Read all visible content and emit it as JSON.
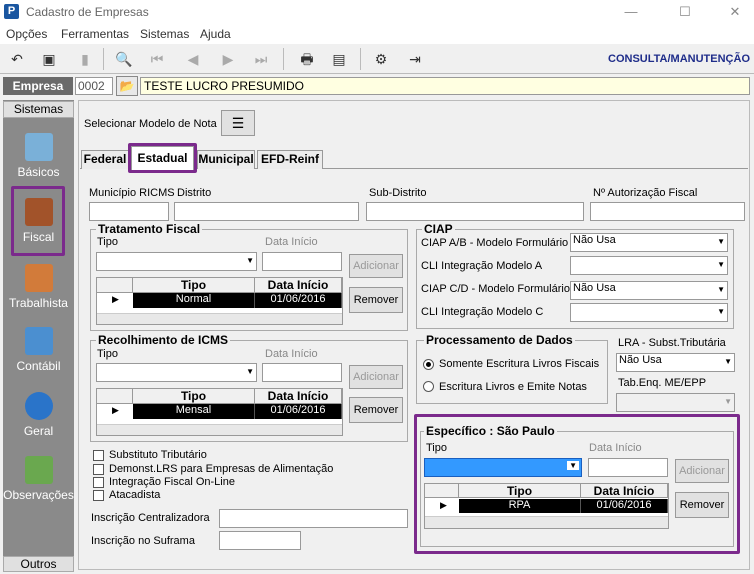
{
  "window": {
    "title": "Cadastro de Empresas",
    "app_letter": "P",
    "min": "—",
    "max": "☐",
    "close": "✕"
  },
  "menu": [
    "Opções",
    "Ferramentas",
    "Sistemas",
    "Ajuda"
  ],
  "toolbar": {
    "mode_label": "CONSULTA/MANUTENÇÃO"
  },
  "empresa": {
    "label": "Empresa",
    "code": "0002",
    "name": "TESTE LUCRO PRESUMIDO"
  },
  "sidebar": {
    "header": "Sistemas",
    "footer": "Outros",
    "items": [
      {
        "label": "Básicos",
        "icon": "document-icon"
      },
      {
        "label": "Fiscal",
        "icon": "book-icon"
      },
      {
        "label": "Trabalhista",
        "icon": "worker-icon"
      },
      {
        "label": "Contábil",
        "icon": "calculator-icon"
      },
      {
        "label": "Geral",
        "icon": "info-icon"
      },
      {
        "label": "Observações",
        "icon": "pen-icon"
      }
    ]
  },
  "modelo_nota": {
    "label": "Selecionar Modelo de Nota"
  },
  "tabs": [
    "Federal",
    "Estadual",
    "Municipal",
    "EFD-Reinf"
  ],
  "fields": {
    "municipio": "Município RICMS",
    "distrito": "Distrito",
    "subdistrito": "Sub-Distrito",
    "autorizacao": "Nº Autorização Fiscal"
  },
  "tratamento": {
    "title": "Tratamento Fiscal",
    "tipo": "Tipo",
    "data_inicio": "Data Início",
    "add": "Adicionar",
    "remove": "Remover",
    "col_tipo": "Tipo",
    "col_data": "Data Início",
    "row_tipo": "Normal",
    "row_data": "01/06/2016"
  },
  "recolhimento": {
    "title": "Recolhimento de ICMS",
    "tipo": "Tipo",
    "data_inicio": "Data Início",
    "add": "Adicionar",
    "remove": "Remover",
    "col_tipo": "Tipo",
    "col_data": "Data Início",
    "row_tipo": "Mensal",
    "row_data": "01/06/2016"
  },
  "checkboxes": [
    "Substituto Tributário",
    "Demonst.LRS para Empresas de Alimentação",
    "Integração Fiscal On-Line",
    "Atacadista"
  ],
  "inscricao_central": "Inscrição Centralizadora",
  "inscricao_suframa": "Inscrição no Suframa",
  "ciap": {
    "title": "CIAP",
    "rows": [
      {
        "label": "CIAP  A/B - Modelo Formulário",
        "value": "Não Usa"
      },
      {
        "label": "CLI Integração Modelo A",
        "value": ""
      },
      {
        "label": "CIAP C/D - Modelo Formulário",
        "value": "Não Usa"
      },
      {
        "label": "CLI Integração Modelo C",
        "value": ""
      }
    ]
  },
  "processamento": {
    "title": "Processamento de Dados",
    "opt1": "Somente Escritura Livros Fiscais",
    "opt2": "Escritura Livros e Emite Notas"
  },
  "lra": {
    "label": "LRA - Subst.Tributária",
    "value": "Não Usa",
    "tab_label": "Tab.Enq. ME/EPP"
  },
  "especifico": {
    "title": "Específico : São Paulo",
    "tipo": "Tipo",
    "data_inicio": "Data Início",
    "add": "Adicionar",
    "remove": "Remover",
    "col_tipo": "Tipo",
    "col_data": "Data Início",
    "row_tipo": "RPA",
    "row_data": "01/06/2016"
  },
  "colors": {
    "highlight": "#7b2a8c",
    "brand": "#1f2d8a"
  }
}
